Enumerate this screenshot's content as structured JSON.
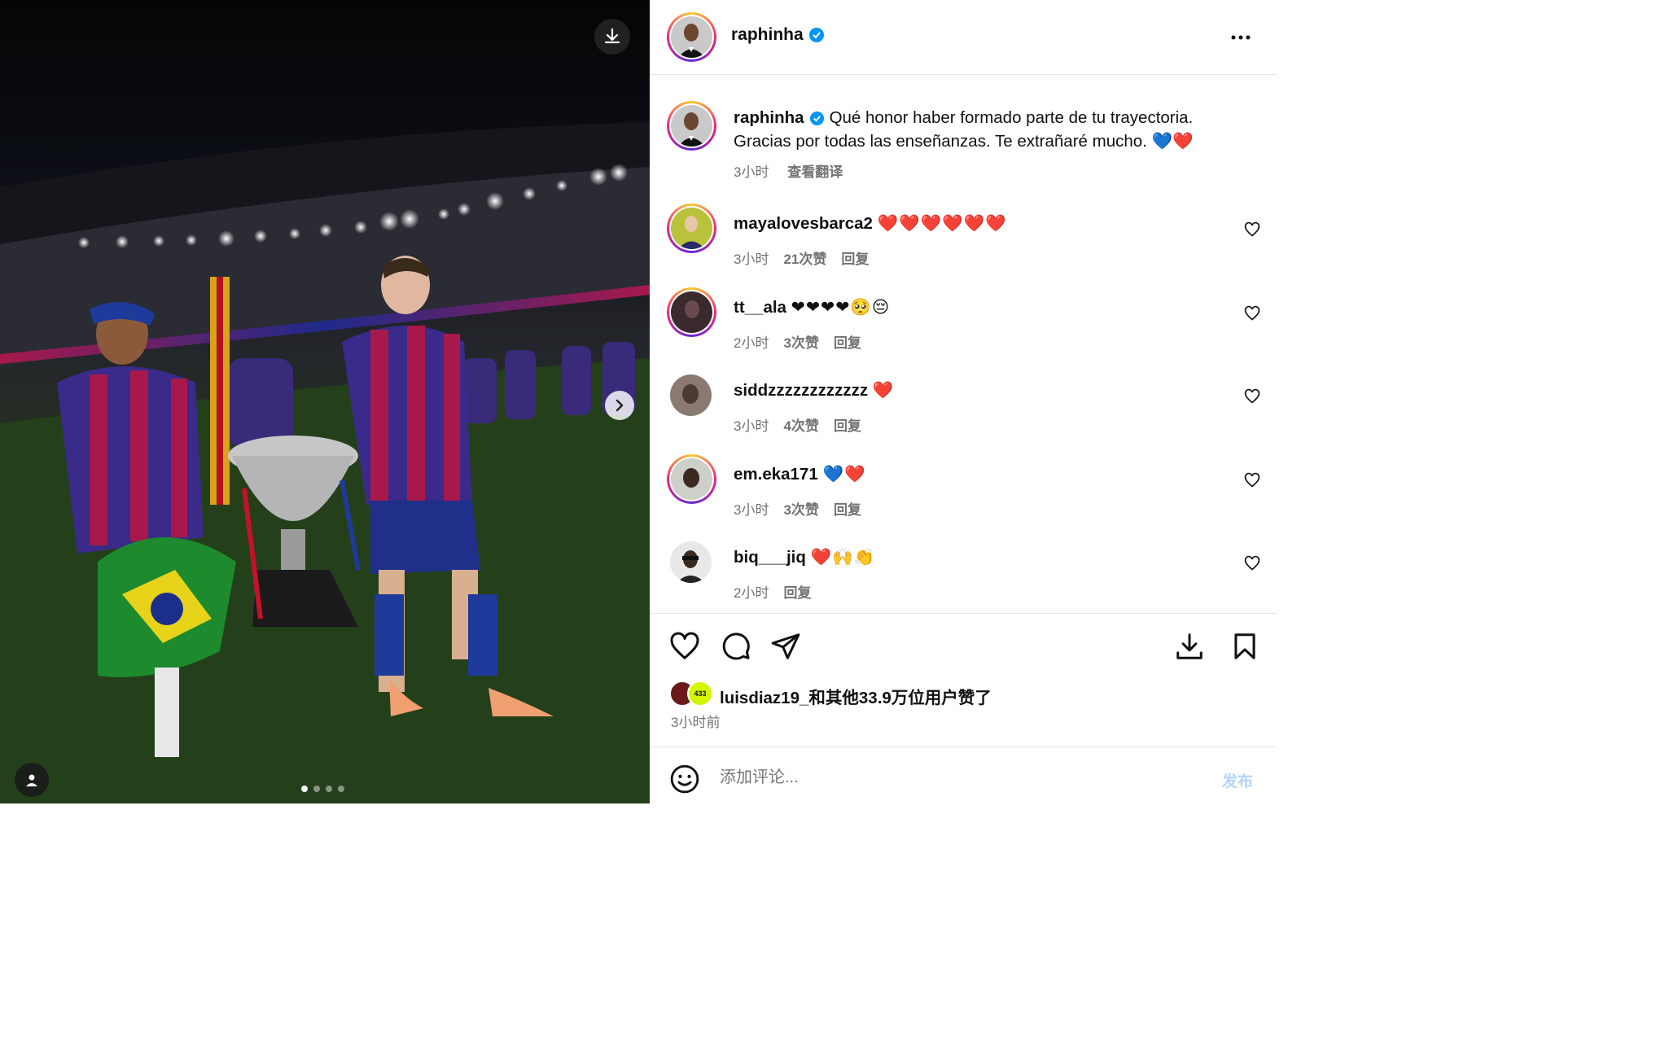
{
  "media": {
    "download_icon": "download-icon",
    "next_icon": "chevron-right-icon",
    "tag_icon": "user-tag-icon",
    "slide_count": 4,
    "active_slide": 1
  },
  "header": {
    "username": "raphinha",
    "verified": true,
    "more_icon": "more-horizontal-icon"
  },
  "caption": {
    "username": "raphinha",
    "text": "Qué honor haber formado parte de tu trayectoria. Gracias por todas las enseñanzas. Te extrañaré mucho. 💙❤️",
    "time": "3小时",
    "translate": "查看翻译"
  },
  "comments": [
    {
      "username": "mayalovesbarca2",
      "text": "❤️❤️❤️❤️❤️❤️",
      "time": "3小时",
      "likes": "21次赞",
      "reply": "回复"
    },
    {
      "username": "tt__ala",
      "text": "❤❤❤❤🥺😔",
      "time": "2小时",
      "likes": "3次赞",
      "reply": "回复"
    },
    {
      "username": "siddzzzzzzzzzzzz",
      "text": "❤️",
      "time": "3小时",
      "likes": "4次赞",
      "reply": "回复"
    },
    {
      "username": "em.eka171",
      "text": "💙❤️",
      "time": "3小时",
      "likes": "3次赞",
      "reply": "回复"
    },
    {
      "username": "biq___jiq",
      "text": "❤️🙌👏",
      "time": "2小时",
      "likes": "",
      "reply": "回复"
    }
  ],
  "actions": {
    "like_icon": "heart-icon",
    "comment_icon": "comment-icon",
    "share_icon": "send-icon",
    "save_to_device_icon": "download-icon",
    "bookmark_icon": "bookmark-icon"
  },
  "likes_summary": {
    "text": "luisdiaz19_和其他33.9万位用户赞了",
    "badge": "433",
    "time": "3小时前"
  },
  "comment_box": {
    "emoji_icon": "smiley-icon",
    "placeholder": "添加评论...",
    "post_label": "发布"
  },
  "colors": {
    "verified": "#0095f6",
    "muted": "#737373",
    "post_disabled": "#b3d4fc",
    "ring_start": "#f9ce34",
    "ring_mid": "#ee2a7b",
    "ring_end": "#6228d7"
  }
}
